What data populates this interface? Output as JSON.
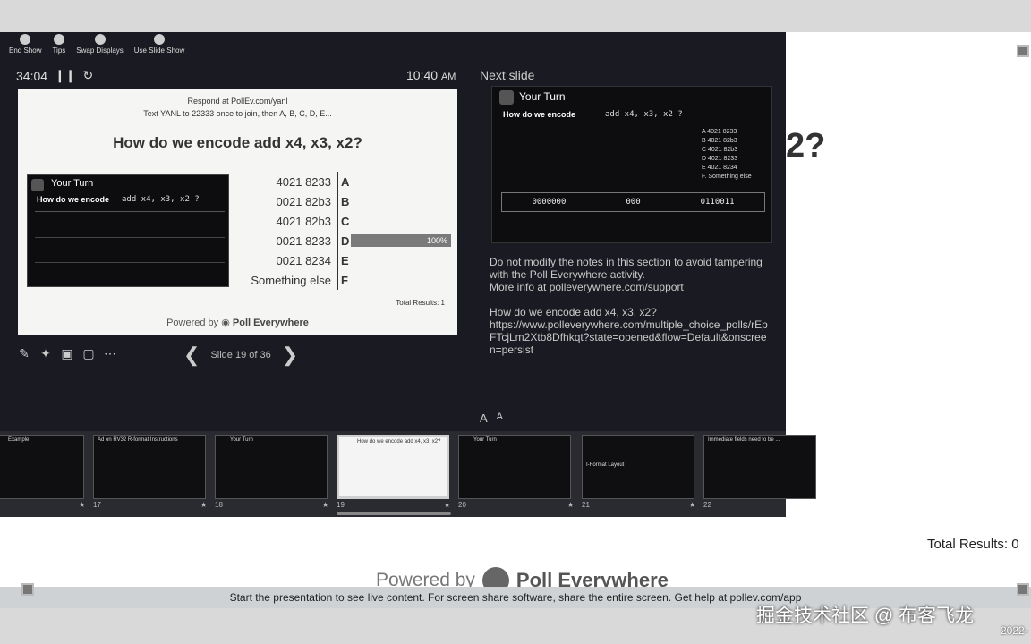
{
  "background": {
    "question_partial": "2?",
    "total_results": "Total Results: 0",
    "powered_by": "Powered by",
    "brand": "Poll Everywhere",
    "bottom_bar": "Start the presentation to see live content. For screen share software, share the entire screen. Get help at pollev.com/app",
    "watermark": "掘金技术社区 @ 布客飞龙",
    "watermark_date": "2022-"
  },
  "toolbar": {
    "items": [
      {
        "label": "End Show",
        "icon": "end-show-icon"
      },
      {
        "label": "Tips",
        "icon": "info-icon"
      },
      {
        "label": "Swap Displays",
        "icon": "swap-icon"
      },
      {
        "label": "Use Slide Show",
        "icon": "slideshow-icon"
      }
    ]
  },
  "timer": {
    "elapsed": "34:04"
  },
  "clock": {
    "time": "10:40",
    "ampm": "AM"
  },
  "next_slide_label": "Next slide",
  "current_slide": {
    "respond_line": "Respond at PollEv.com/yanl",
    "text_line": "Text YANL to 22333 once to join, then A, B, C, D, E...",
    "question": "How do we encode add x4, x3, x2?",
    "embedded": {
      "heading": "Your Turn",
      "question": "How do we encode",
      "code": "add x4, x3, x2 ?"
    },
    "answers": [
      {
        "text": "4021 8233",
        "letter": "A"
      },
      {
        "text": "0021 82b3",
        "letter": "B"
      },
      {
        "text": "4021 82b3",
        "letter": "C"
      },
      {
        "text": "0021 8233",
        "letter": "D",
        "percent": "100%",
        "share": 1.0
      },
      {
        "text": "0021 8234",
        "letter": "E"
      },
      {
        "text": "Something else",
        "letter": "F"
      }
    ],
    "total_results": "Total Results: 1",
    "powered_by": "Powered by",
    "brand": "Poll Everywhere"
  },
  "navigation": {
    "label": "Slide 19 of 36"
  },
  "next_slide": {
    "heading": "Your Turn",
    "question": "How do we encode",
    "code": "add x4, x3, x2 ?",
    "options": [
      "A  4021 8233",
      "B  4021 82b3",
      "C  4021 82b3",
      "D  4021 8233",
      "E  4021 8234",
      "F.  Something else"
    ],
    "bottom_fields": [
      "0000000",
      "000",
      "0110011"
    ]
  },
  "notes": {
    "paragraph1": "Do not modify the notes in this section to avoid tampering with the Poll Everywhere activity.",
    "paragraph1b": "More info at polleverywhere.com/support",
    "paragraph2": "How do we encode add x4, x3, x2?",
    "paragraph2b": "https://www.polleverywhere.com/multiple_choice_polls/rEpFTcjLm2Xtb8Dfhkqt?state=opened&flow=Default&onscreen=persist"
  },
  "font_controls": {
    "increase": "A",
    "decrease": "A"
  },
  "thumbnails": [
    {
      "num": "",
      "title": "Example"
    },
    {
      "num": "17",
      "title": "Ad on RV32 R-format Instructions"
    },
    {
      "num": "18",
      "title": "Your Turn"
    },
    {
      "num": "19",
      "title": "How do we encode add x4, x3, x2?"
    },
    {
      "num": "20",
      "title": "Your Turn"
    },
    {
      "num": "21",
      "title": "I-Format Layout"
    },
    {
      "num": "22",
      "title": "Immediate fields need to be ..."
    }
  ]
}
